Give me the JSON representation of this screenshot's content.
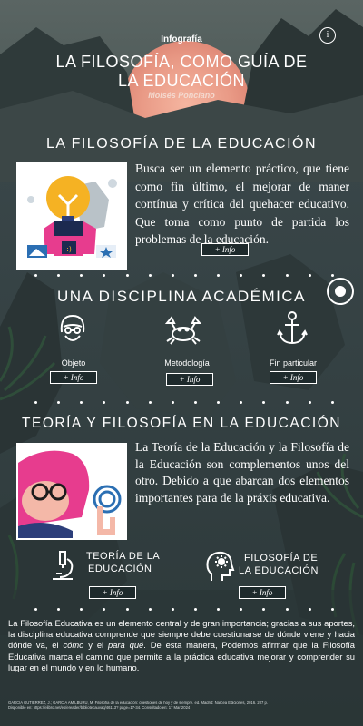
{
  "header": {
    "kicker": "Infografía",
    "title_line1": "LA FILOSOFÍA, COMO GUÍA DE",
    "title_line2": "LA EDUCACIÓN",
    "author": "Moisés Ponciano",
    "info_icon": "i"
  },
  "section1": {
    "title": "LA FILOSOFÍA DE LA EDUCACIÓN",
    "text": "Busca ser un elemento práctico, que tiene como fin último, el mejorar de maner contínua y crítica del quehacer educativo. Que toma como punto de partida los problemas de la educación.",
    "button": "+ Info"
  },
  "section2": {
    "title": "UNA DISCIPLINA ACADÉMICA",
    "items": [
      {
        "label": "Objeto",
        "button": "+ Info",
        "icon": "user-head-icon"
      },
      {
        "label": "Metodología",
        "button": "+ Info",
        "icon": "crab-icon"
      },
      {
        "label": "Fin particular",
        "button": "+ Info",
        "icon": "anchor-icon"
      }
    ]
  },
  "section3": {
    "title": "TEORÍA Y FILOSOFÍA EN LA EDUCACIÓN",
    "text": "La Teoría de la Educación y la Filosofía de la Educación son complementos unos del otro. Debido a que abarcan dos elementos importantes para de la práxis educativa.",
    "items": [
      {
        "label_line1": "TEORÍA DE LA",
        "label_line2": "EDUCACIÓN",
        "button": "+ Info",
        "icon": "microscope-icon"
      },
      {
        "label_line1": "FILOSOFÍA DE",
        "label_line2": "LA EDUCACIÓN",
        "button": "+ Info",
        "icon": "brain-gear-icon"
      }
    ]
  },
  "closing": {
    "text_part1": "La Filosofía Educativa es un elemento central y de gran importancia; gracias a sus aportes, la disciplina educativa comprende que siempre debe cuestionarse de dónde viene y hacia dónde va, el ",
    "em1": "cómo",
    "text_part2": " y el ",
    "em2": "para qué",
    "text_part3": ". De esta manera, Podemos afirmar que la Filosofía Educativa marca el camino que permite a la práctica educativa mejorar y comprender su lugar en el mundo y en lo humano."
  },
  "reference": "GARCÍA GUTIÉRREZ, J.; GARCÍA AMILBURU, M. Filosofía de la educación: cuestiones de hoy y de siempre. ed. Madrid: Narcea Ediciones, 2016. 207 p. Disponible en: https://elibro.net/es/ereader/bibliotecauvaq/46113? page=17-34. Consultado en: 17 Mar 2024",
  "colors": {
    "accent_sun": "#f0a080",
    "bg_dark": "#2e3b3d",
    "button_border": "#ffffff"
  }
}
